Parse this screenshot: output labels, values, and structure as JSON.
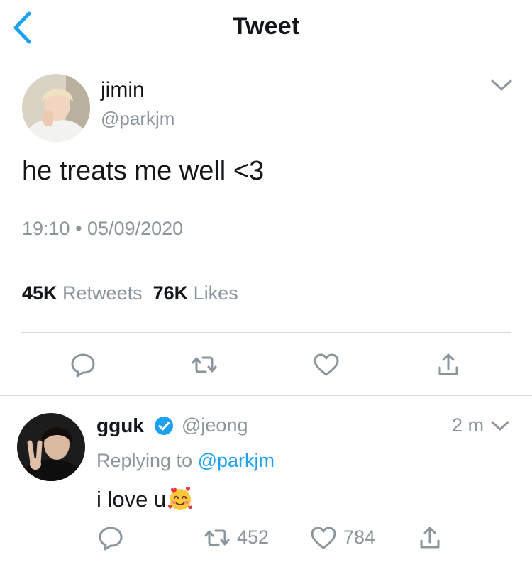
{
  "header": {
    "title": "Tweet",
    "back_icon": "chevron-left-icon",
    "accent": "#1da1f2"
  },
  "tweet": {
    "author_name": "jimin",
    "author_handle": "@parkjm",
    "text": "he treats me well <3",
    "timestamp": "19:10 • 05/09/2020",
    "retweet_count": "45K",
    "retweet_label": "Retweets",
    "like_count": "76K",
    "like_label": "Likes",
    "actions": [
      "reply-icon",
      "retweet-icon",
      "heart-icon",
      "share-icon"
    ]
  },
  "reply": {
    "author_name": "gguk",
    "verified": true,
    "author_handle": "@jeong",
    "time": "2 m",
    "replying_prefix": "Replying to",
    "replying_to": "@parkjm",
    "text": "i love u",
    "emoji": "smiling-face-with-hearts",
    "retweet_count": "452",
    "like_count": "784"
  },
  "colors": {
    "muted": "#8b959e",
    "text": "#14171a",
    "divider": "#d4d6d8",
    "verified": "#1da1f2"
  }
}
